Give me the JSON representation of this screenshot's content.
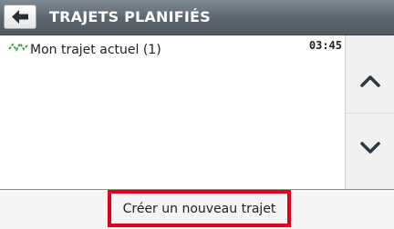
{
  "header": {
    "back_icon": "arrow-left-icon",
    "title": "TRAJETS PLANIFIÉS"
  },
  "routes": [
    {
      "icon": "route-zigzag-icon",
      "name": "Mon trajet actuel (1)",
      "time": "03:45"
    }
  ],
  "scroll": {
    "up_icon": "chevron-up-icon",
    "down_icon": "chevron-down-icon"
  },
  "footer": {
    "new_route_label": "Créer un nouveau trajet"
  },
  "colors": {
    "header_bg": "#5a646d",
    "highlight_border": "#e1001a",
    "route_icon": "#3aa04a"
  }
}
